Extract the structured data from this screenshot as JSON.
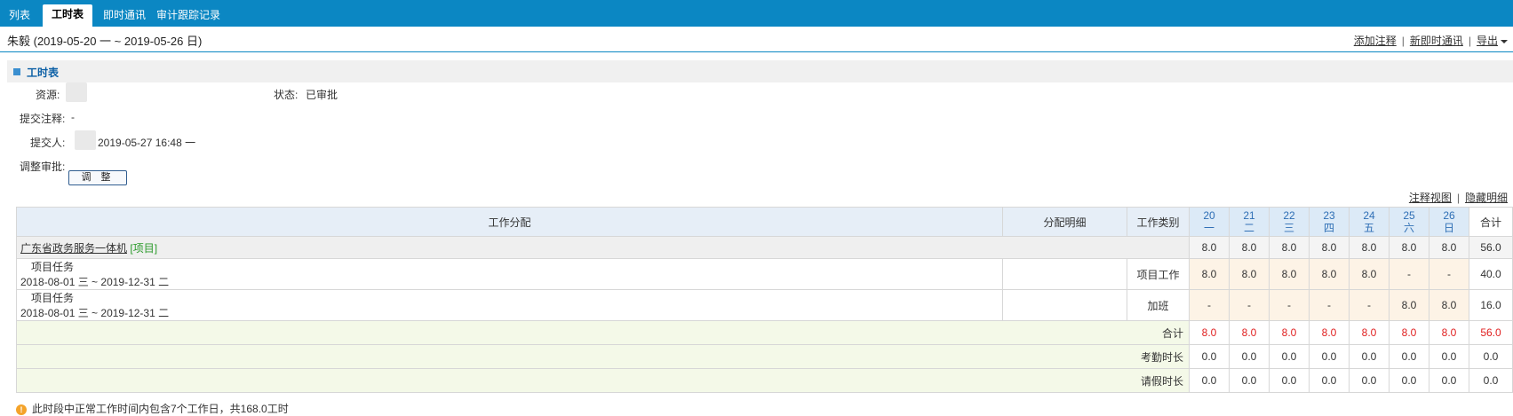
{
  "tabs": [
    {
      "label": "列表"
    },
    {
      "label": "工时表"
    },
    {
      "label": "即时通讯"
    },
    {
      "label": "审计跟踪记录"
    }
  ],
  "page": {
    "title": "朱毅 (2019-05-20 一 ~ 2019-05-26 日)",
    "links": {
      "add_note": "添加注释",
      "new_im": "新即时通讯",
      "export": "导出"
    }
  },
  "section": {
    "title": "工时表"
  },
  "fields": {
    "resource_label": "资源:",
    "status_label": "状态:",
    "status_value": "已审批",
    "note_label": "提交注释:",
    "note_value": "-",
    "submitter_label": "提交人:",
    "submit_time": "2019-05-27 16:48 一",
    "adjust_label": "调整审批:",
    "adjust_button": "调 整"
  },
  "view_links": {
    "note_view": "注释视图",
    "hide_detail": "隐藏明细"
  },
  "grid": {
    "headers": {
      "work": "工作分配",
      "detail": "分配明细",
      "category": "工作类别",
      "total": "合计"
    },
    "days": [
      {
        "date": "20",
        "weekday": "一"
      },
      {
        "date": "21",
        "weekday": "二"
      },
      {
        "date": "22",
        "weekday": "三"
      },
      {
        "date": "23",
        "weekday": "四"
      },
      {
        "date": "24",
        "weekday": "五"
      },
      {
        "date": "25",
        "weekday": "六"
      },
      {
        "date": "26",
        "weekday": "日"
      }
    ],
    "project": {
      "name": "广东省政务服务一体机",
      "tag": "[项目]",
      "values": [
        "8.0",
        "8.0",
        "8.0",
        "8.0",
        "8.0",
        "8.0",
        "8.0"
      ],
      "total": "56.0"
    },
    "tasks": [
      {
        "name": "项目任务",
        "range": "2018-08-01 三 ~ 2019-12-31 二",
        "category": "项目工作",
        "values": [
          "8.0",
          "8.0",
          "8.0",
          "8.0",
          "8.0",
          "-",
          "-"
        ],
        "total": "40.0"
      },
      {
        "name": "项目任务",
        "range": "2018-08-01 三 ~ 2019-12-31 二",
        "category": "加班",
        "values": [
          "-",
          "-",
          "-",
          "-",
          "-",
          "8.0",
          "8.0"
        ],
        "total": "16.0"
      }
    ],
    "summary": [
      {
        "label": "合计",
        "values": [
          "8.0",
          "8.0",
          "8.0",
          "8.0",
          "8.0",
          "8.0",
          "8.0"
        ],
        "total": "56.0"
      },
      {
        "label": "考勤时长",
        "values": [
          "0.0",
          "0.0",
          "0.0",
          "0.0",
          "0.0",
          "0.0",
          "0.0"
        ],
        "total": "0.0"
      },
      {
        "label": "请假时长",
        "values": [
          "0.0",
          "0.0",
          "0.0",
          "0.0",
          "0.0",
          "0.0",
          "0.0"
        ],
        "total": "0.0"
      }
    ]
  },
  "notice": "此时段中正常工作时间内包含7个工作日，共168.0工时",
  "colors": {
    "accent": "#0b87c3",
    "red": "#e02020",
    "project_tag": "#2a9a2a"
  }
}
